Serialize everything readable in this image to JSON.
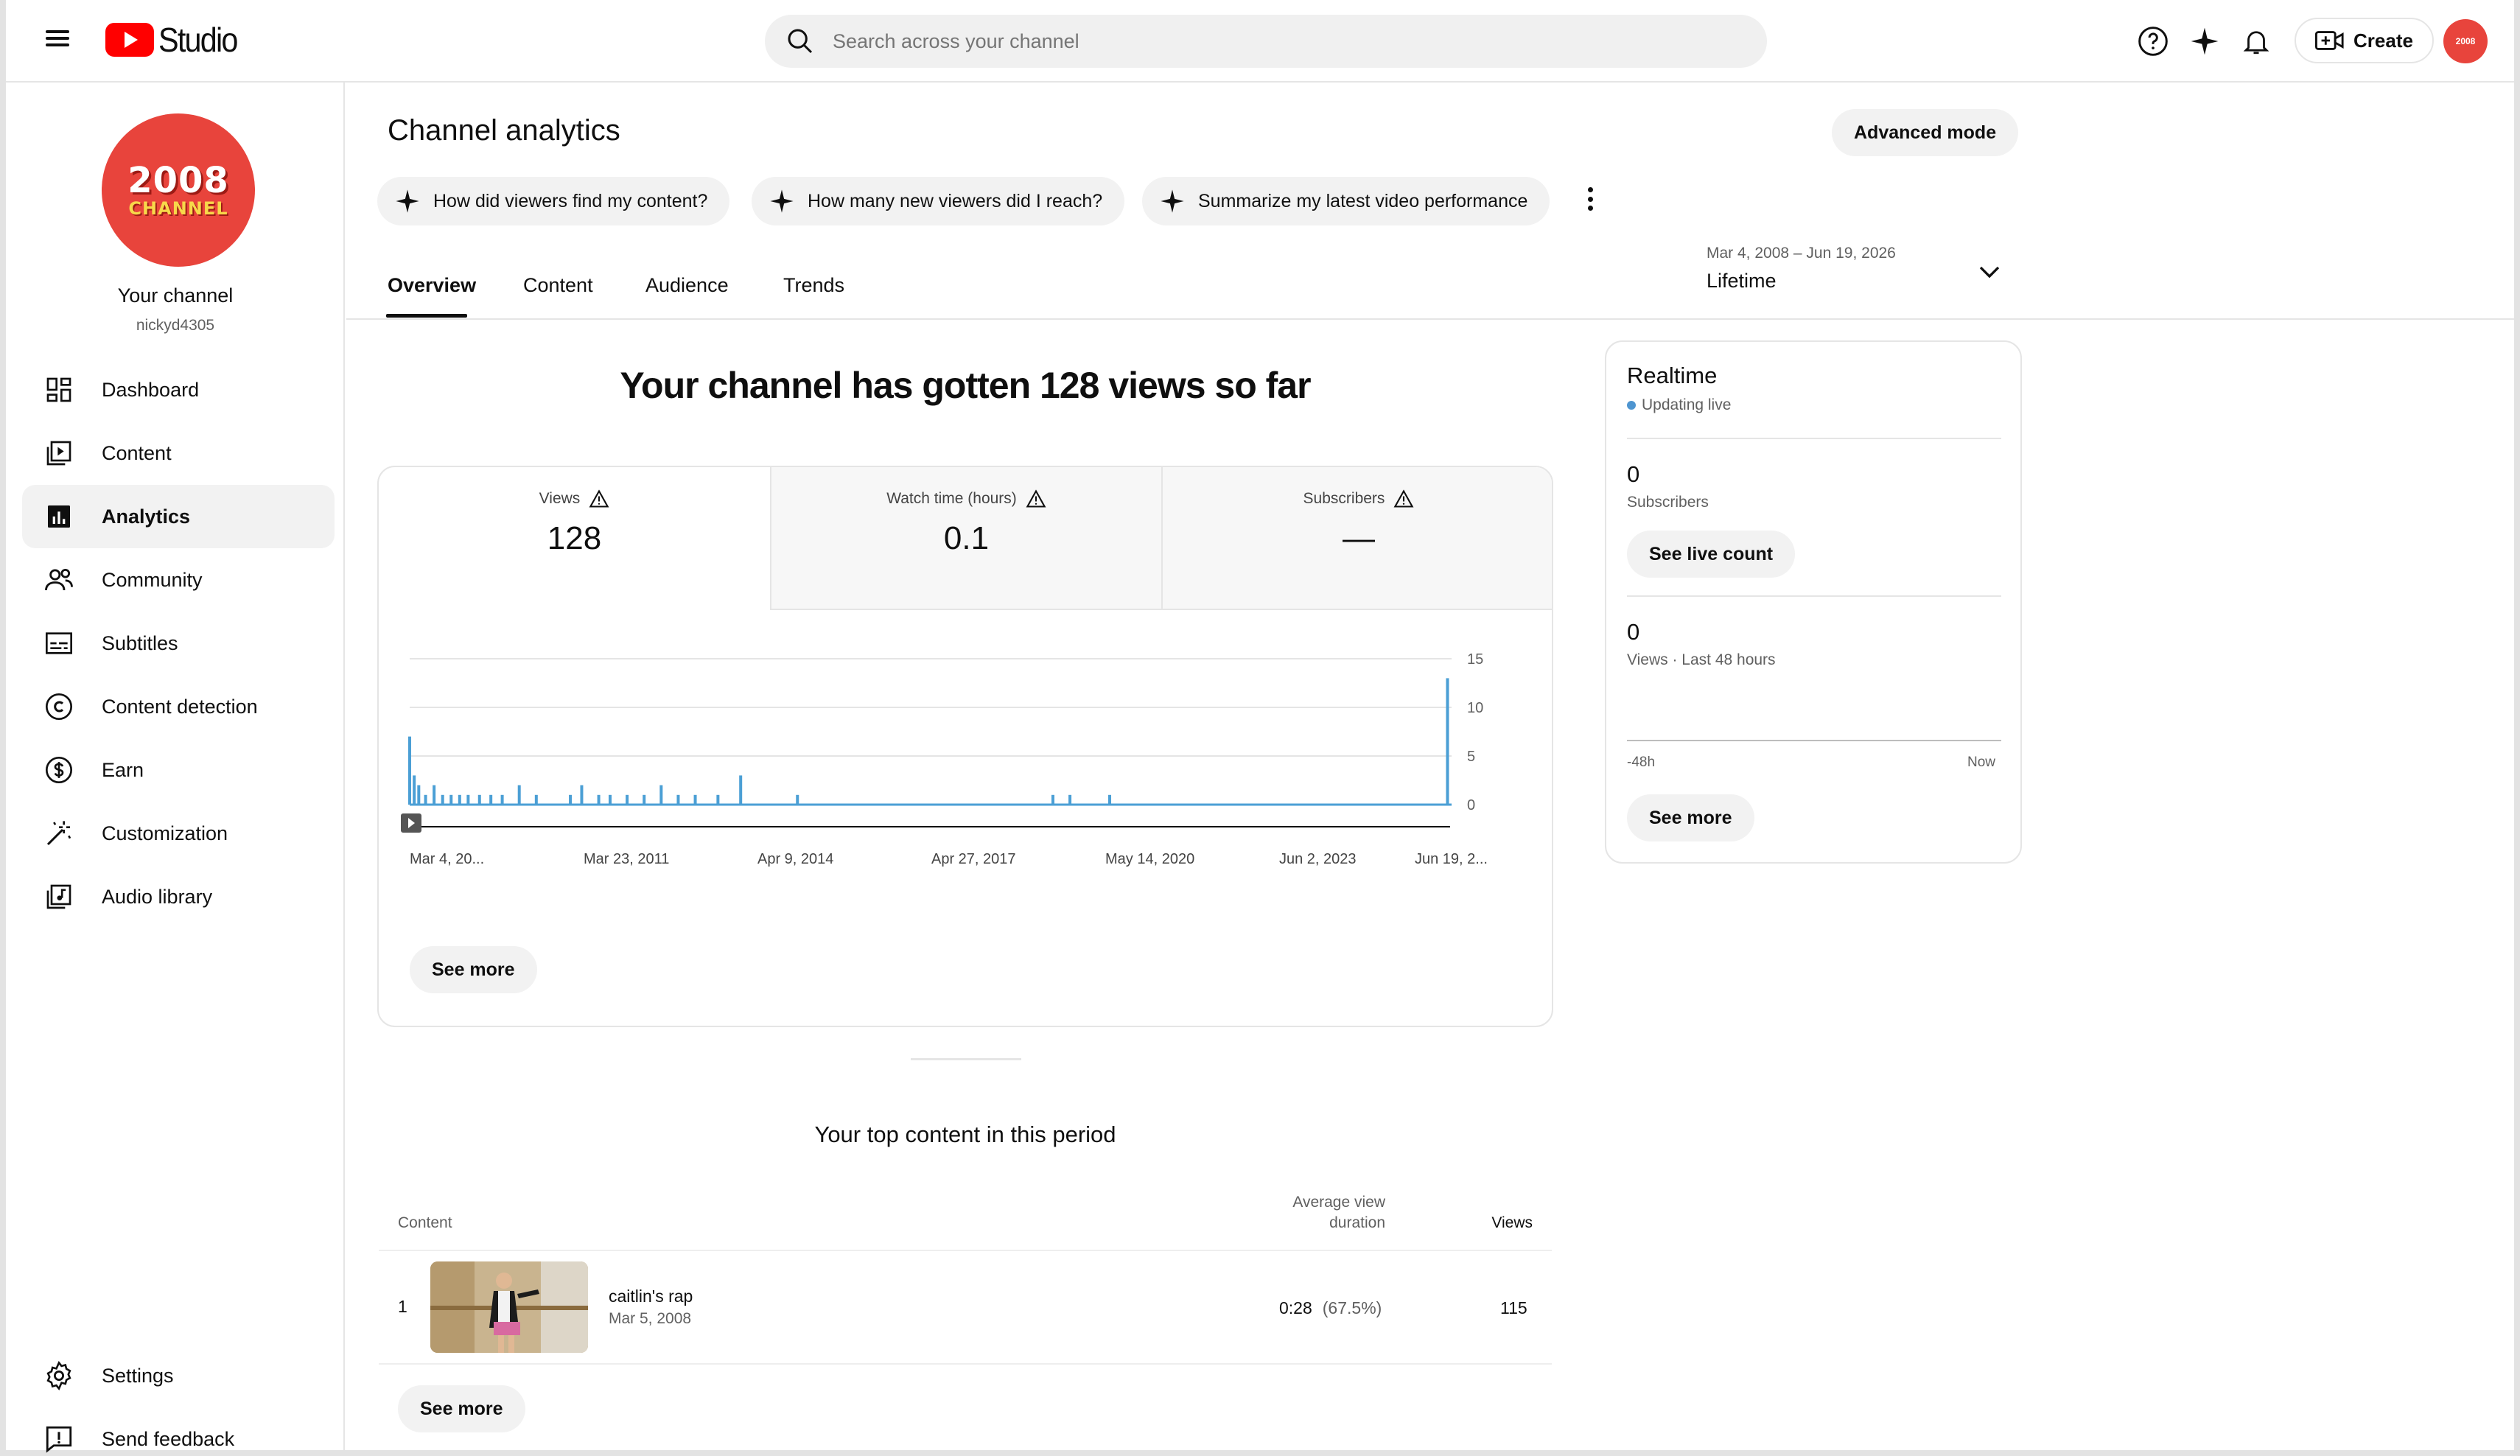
{
  "header": {
    "logo_text": "Studio",
    "search_placeholder": "Search across your channel",
    "create_label": "Create",
    "avatar_text": "2008"
  },
  "channel": {
    "avatar_big": "2008",
    "avatar_small": "CHANNEL",
    "name": "Your channel",
    "handle": "nickyd4305"
  },
  "sidebar": {
    "items": [
      {
        "label": "Dashboard",
        "icon": "dashboard-icon"
      },
      {
        "label": "Content",
        "icon": "content-icon"
      },
      {
        "label": "Analytics",
        "icon": "analytics-icon",
        "active": true
      },
      {
        "label": "Community",
        "icon": "community-icon"
      },
      {
        "label": "Subtitles",
        "icon": "subtitles-icon"
      },
      {
        "label": "Content detection",
        "icon": "copyright-icon"
      },
      {
        "label": "Earn",
        "icon": "dollar-icon"
      },
      {
        "label": "Customization",
        "icon": "magic-wand-icon"
      },
      {
        "label": "Audio library",
        "icon": "audio-library-icon"
      }
    ],
    "bottom": [
      {
        "label": "Settings",
        "icon": "gear-icon"
      },
      {
        "label": "Send feedback",
        "icon": "feedback-icon"
      }
    ]
  },
  "page": {
    "title": "Channel analytics",
    "advanced_mode": "Advanced mode",
    "chips": [
      "How did viewers find my content?",
      "How many new viewers did I reach?",
      "Summarize my latest video performance"
    ],
    "tabs": [
      "Overview",
      "Content",
      "Audience",
      "Trends"
    ],
    "active_tab": "Overview",
    "date_range": "Mar 4, 2008 – Jun 19, 2026",
    "date_label": "Lifetime",
    "headline": "Your channel has gotten 128 views so far"
  },
  "metrics": [
    {
      "label": "Views",
      "value": "128"
    },
    {
      "label": "Watch time (hours)",
      "value": "0.1"
    },
    {
      "label": "Subscribers",
      "value": "—"
    }
  ],
  "chart_data": {
    "type": "bar",
    "x_tick_labels": [
      "Mar 4, 20...",
      "Mar 23, 2011",
      "Apr 9, 2014",
      "Apr 27, 2017",
      "May 14, 2020",
      "Jun 2, 2023",
      "Jun 19, 2..."
    ],
    "y_ticks": [
      0,
      5,
      10,
      15
    ],
    "ylim": [
      0,
      15
    ],
    "series": [
      {
        "color": "#4b9fd5",
        "points": [
          {
            "x": 2008.17,
            "y": 7
          },
          {
            "x": 2008.25,
            "y": 3
          },
          {
            "x": 2008.33,
            "y": 2
          },
          {
            "x": 2008.45,
            "y": 1
          },
          {
            "x": 2008.6,
            "y": 2
          },
          {
            "x": 2008.75,
            "y": 1
          },
          {
            "x": 2008.9,
            "y": 1
          },
          {
            "x": 2009.05,
            "y": 1
          },
          {
            "x": 2009.2,
            "y": 1
          },
          {
            "x": 2009.4,
            "y": 1
          },
          {
            "x": 2009.6,
            "y": 1
          },
          {
            "x": 2009.8,
            "y": 1
          },
          {
            "x": 2010.1,
            "y": 2
          },
          {
            "x": 2010.4,
            "y": 1
          },
          {
            "x": 2011.0,
            "y": 1
          },
          {
            "x": 2011.2,
            "y": 2
          },
          {
            "x": 2011.5,
            "y": 1
          },
          {
            "x": 2011.7,
            "y": 1
          },
          {
            "x": 2012.0,
            "y": 1
          },
          {
            "x": 2012.3,
            "y": 1
          },
          {
            "x": 2012.6,
            "y": 2
          },
          {
            "x": 2012.9,
            "y": 1
          },
          {
            "x": 2013.2,
            "y": 1
          },
          {
            "x": 2013.6,
            "y": 1
          },
          {
            "x": 2014.0,
            "y": 3
          },
          {
            "x": 2015.0,
            "y": 1
          },
          {
            "x": 2019.5,
            "y": 1
          },
          {
            "x": 2019.8,
            "y": 1
          },
          {
            "x": 2020.5,
            "y": 1
          },
          {
            "x": 2026.45,
            "y": 13
          }
        ]
      }
    ],
    "see_more": "See more"
  },
  "top_content": {
    "title": "Your top content in this period",
    "col_content": "Content",
    "col_avd_line1": "Average view",
    "col_avd_line2": "duration",
    "col_views": "Views",
    "rows": [
      {
        "rank": "1",
        "title": "caitlin's rap",
        "date": "Mar 5, 2008",
        "avd": "0:28",
        "avd_pct": "(67.5%)",
        "views": "115"
      }
    ],
    "see_more": "See more"
  },
  "realtime": {
    "title": "Realtime",
    "status": "Updating live",
    "subs_value": "0",
    "subs_label": "Subscribers",
    "live_count_btn": "See live count",
    "views_value": "0",
    "views_label": "Views · Last 48 hours",
    "axis_start": "-48h",
    "axis_end": "Now",
    "see_more": "See more"
  }
}
